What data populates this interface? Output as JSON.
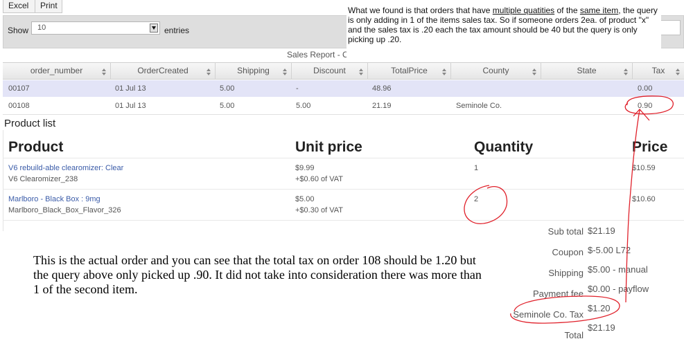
{
  "toolbar": {
    "excel": "Excel",
    "print": "Print"
  },
  "controls": {
    "show": "Show",
    "entries_value": "10",
    "entries": "entries"
  },
  "report_title": "Sales Report - C",
  "note": {
    "p1": "What we found is that orders that have ",
    "u1": "multiple quatities",
    "p2": " of the ",
    "u2": "same item",
    "p3": ", the query is only adding in 1 of the items sales tax.  So if someone orders 2ea. of product  \"x\" and the sales tax is .20 each the tax amount should be 40 but the query is only picking up .20."
  },
  "table": {
    "columns": [
      "order_number",
      "OrderCreated",
      "Shipping",
      "Discount",
      "TotalPrice",
      "County",
      "State",
      "Tax"
    ],
    "rows": [
      [
        "00107",
        "01 Jul 13",
        "5.00",
        "-",
        "48.96",
        "",
        "",
        "0.00"
      ],
      [
        "00108",
        "01 Jul 13",
        "5.00",
        "5.00",
        "21.19",
        "Seminole Co.",
        "",
        "0.90"
      ]
    ]
  },
  "products": {
    "title": "Product list",
    "headers": {
      "product": "Product",
      "unit_price": "Unit price",
      "quantity": "Quantity",
      "price": "Price"
    },
    "items": [
      {
        "name": "V6 rebuild-able clearomizer: Clear",
        "sku": "V6 Clearomizer_238",
        "unit": "$9.99",
        "vat": "+$0.60 of VAT",
        "qty": "1",
        "price": "$10.59"
      },
      {
        "name": "Marlboro - Black Box : 9mg",
        "sku": "Marlboro_Black_Box_Flavor_326",
        "unit": "$5.00",
        "vat": "+$0.30 of VAT",
        "qty": "2",
        "price": "$10.60"
      }
    ]
  },
  "totals": [
    {
      "label": "Sub total",
      "value": "$21.19"
    },
    {
      "label": "Coupon",
      "value": "$-5.00 L72"
    },
    {
      "label": "Shipping",
      "value": "$5.00 - manual"
    },
    {
      "label": "Payment fee",
      "value": "$0.00 - payflow"
    },
    {
      "label": "Seminole Co. Tax",
      "value": "$1.20"
    },
    {
      "label": "Total",
      "value": "$21.19"
    }
  ],
  "bottom_note": "This is the actual order and you can see that the total tax on order 108 should be 1.20 but the query above only picked up .90.  It did not take into consideration there was more than 1 of the second item.",
  "colors": {
    "highlight_row": "#e3e4f7",
    "link": "#3a5ba8",
    "annotation": "#e0202a"
  }
}
